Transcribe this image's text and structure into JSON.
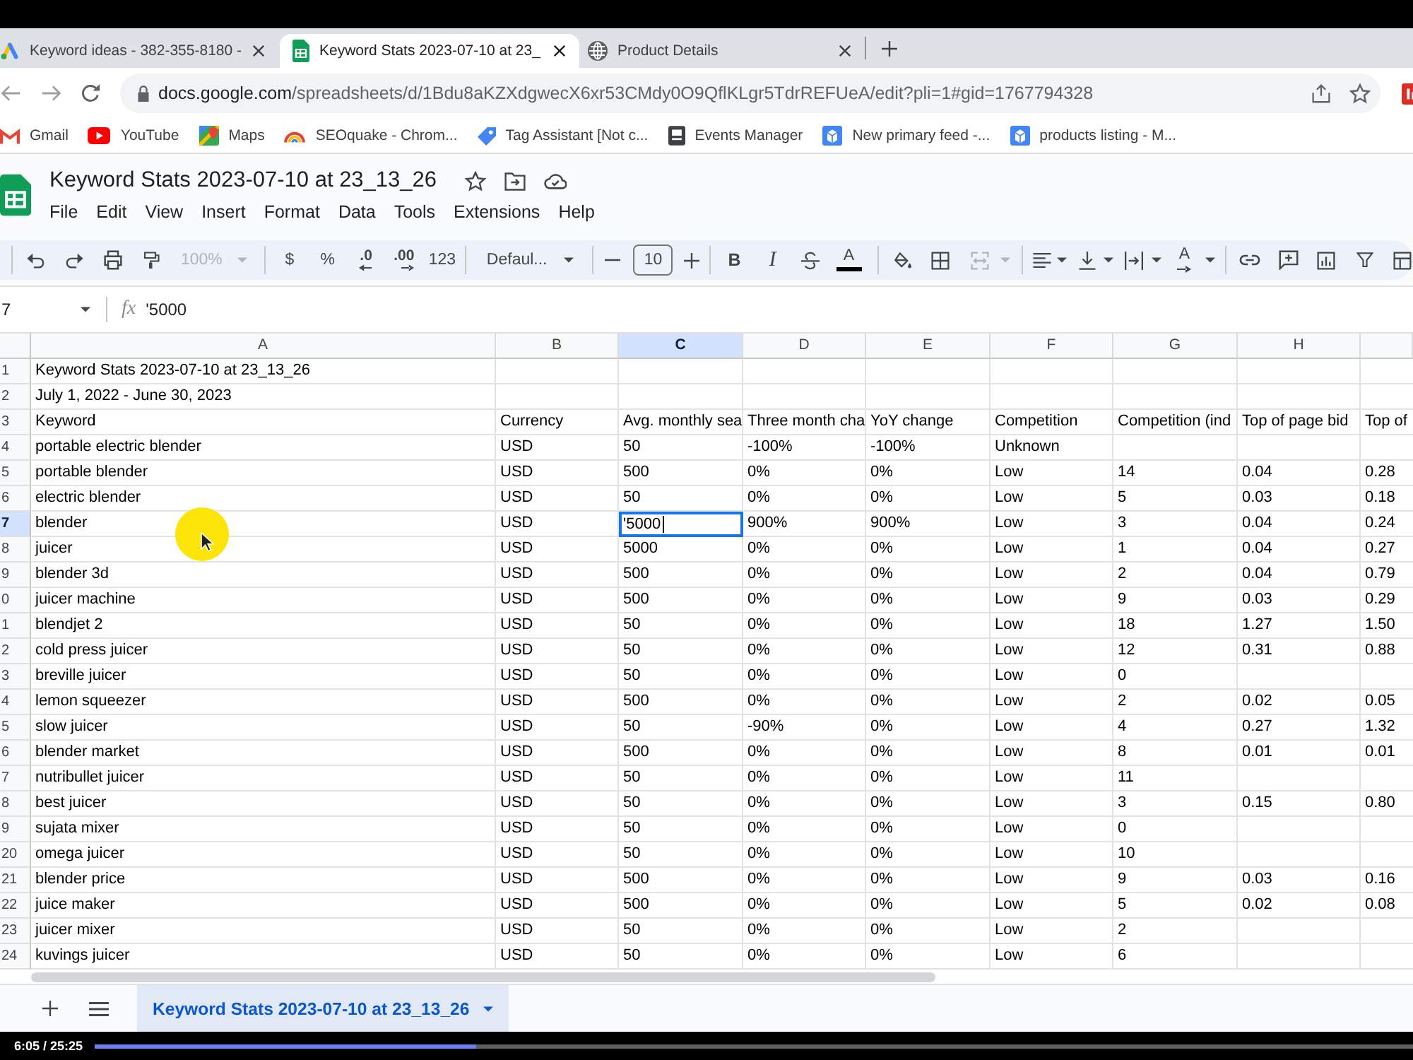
{
  "browser": {
    "tabs": [
      {
        "kind": "ads",
        "title": "Keyword ideas - 382-355-8180 -",
        "selected": false
      },
      {
        "kind": "sheets",
        "title": "Keyword Stats 2023-07-10 at 23_",
        "selected": true
      },
      {
        "kind": "globe",
        "title": "Product Details",
        "selected": false
      }
    ],
    "address": {
      "host": "docs.google.com",
      "path": "/spreadsheets/d/1Bdu8aKZXdgwecX6xr53CMdy0O9QflKLgr5TdrREFUeA/edit?pli=1#gid=1767794328"
    },
    "bookmarks": [
      {
        "kind": "gmail",
        "label": "Gmail"
      },
      {
        "kind": "youtube",
        "label": "YouTube"
      },
      {
        "kind": "maps",
        "label": "Maps"
      },
      {
        "kind": "seoquake",
        "label": "SEOquake - Chrom..."
      },
      {
        "kind": "tag",
        "label": "Tag Assistant [Not c..."
      },
      {
        "kind": "events",
        "label": "Events Manager"
      },
      {
        "kind": "merchant",
        "label": "New primary feed -..."
      },
      {
        "kind": "merchant",
        "label": "products listing - M..."
      }
    ]
  },
  "document": {
    "title": "Keyword Stats 2023-07-10 at 23_13_26",
    "menu": [
      "File",
      "Edit",
      "View",
      "Insert",
      "Format",
      "Data",
      "Tools",
      "Extensions",
      "Help"
    ]
  },
  "toolbar": [
    [
      {
        "kind": "undo",
        "disabled": false
      },
      {
        "kind": "redo",
        "disabled": false
      },
      {
        "kind": "print",
        "disabled": false
      },
      {
        "kind": "paint-format",
        "disabled": false
      },
      {
        "kind": "zoom",
        "label": "100%",
        "disabled": true
      }
    ],
    [
      {
        "kind": "currency",
        "label": "$",
        "disabled": false
      },
      {
        "kind": "percent",
        "label": "%",
        "disabled": false
      },
      {
        "kind": "decrease-decimals",
        "label": ".0",
        "disabled": false
      },
      {
        "kind": "increase-decimals",
        "label": ".00",
        "disabled": false
      },
      {
        "kind": "number-format",
        "label": "123",
        "disabled": false
      }
    ],
    [
      {
        "kind": "font",
        "label": "Defaul...",
        "disabled": false
      }
    ],
    [
      {
        "kind": "minus",
        "disabled": false
      },
      {
        "kind": "size-field",
        "label": "10",
        "disabled": false
      },
      {
        "kind": "plus",
        "disabled": false
      }
    ],
    [
      {
        "kind": "bold",
        "label": "B",
        "disabled": false
      },
      {
        "kind": "italic",
        "label": "I",
        "disabled": false
      },
      {
        "kind": "strikethrough",
        "disabled": false
      },
      {
        "kind": "text-color",
        "label": "A",
        "disabled": false
      }
    ],
    [
      {
        "kind": "fill-color",
        "disabled": false
      },
      {
        "kind": "borders",
        "disabled": false
      },
      {
        "kind": "merge",
        "disabled": true
      }
    ],
    [
      {
        "kind": "align",
        "disabled": false
      },
      {
        "kind": "valign",
        "disabled": false
      },
      {
        "kind": "wrap",
        "disabled": false
      },
      {
        "kind": "rotate",
        "label": "A",
        "disabled": false
      }
    ],
    [
      {
        "kind": "link",
        "disabled": false
      },
      {
        "kind": "comment",
        "disabled": false
      },
      {
        "kind": "chart",
        "disabled": false
      },
      {
        "kind": "filter",
        "disabled": false
      },
      {
        "kind": "views",
        "disabled": false
      }
    ]
  ],
  "formula_bar": {
    "cell": "7",
    "fx": "fx",
    "value": "'5000"
  },
  "sheet": {
    "columns": [
      {
        "label": "A",
        "selected": false
      },
      {
        "label": "B",
        "selected": false
      },
      {
        "label": "C",
        "selected": true
      },
      {
        "label": "D",
        "selected": false
      },
      {
        "label": "E",
        "selected": false
      },
      {
        "label": "F",
        "selected": false
      },
      {
        "label": "G",
        "selected": false
      },
      {
        "label": "H",
        "selected": false
      },
      {
        "selected": false
      }
    ],
    "rows": [
      {
        "number": "1",
        "selected": false,
        "cells": [
          "Keyword Stats 2023-07-10 at 23_13_26"
        ]
      },
      {
        "number": "2",
        "selected": false,
        "cells": [
          "July 1, 2022 - June 30, 2023"
        ]
      },
      {
        "number": "3",
        "selected": false,
        "cells": [
          "Keyword",
          "Currency",
          "Avg. monthly sea",
          "Three month cha",
          "YoY change",
          "Competition",
          "Competition (ind",
          "Top of page bid",
          "Top of"
        ]
      },
      {
        "number": "4",
        "selected": false,
        "cells": [
          "portable electric blender",
          "USD",
          "50",
          "-100%",
          "-100%",
          "Unknown"
        ]
      },
      {
        "number": "5",
        "selected": false,
        "cells": [
          "portable blender",
          "USD",
          "500",
          "0%",
          "0%",
          "Low",
          "14",
          "0.04",
          "0.28"
        ]
      },
      {
        "number": "6",
        "selected": false,
        "cells": [
          "electric blender",
          "USD",
          "50",
          "0%",
          "0%",
          "Low",
          "5",
          "0.03",
          "0.18"
        ]
      },
      {
        "number": "7",
        "selected": true,
        "cells": [
          "blender",
          "USD",
          "'5000",
          "900%",
          "900%",
          "Low",
          "3",
          "0.04",
          "0.24"
        ]
      },
      {
        "number": "8",
        "selected": false,
        "cells": [
          "juicer",
          "USD",
          "5000",
          "0%",
          "0%",
          "Low",
          "1",
          "0.04",
          "0.27"
        ]
      },
      {
        "number": "9",
        "selected": false,
        "cells": [
          "blender 3d",
          "USD",
          "500",
          "0%",
          "0%",
          "Low",
          "2",
          "0.04",
          "0.79"
        ]
      },
      {
        "number": "0",
        "selected": false,
        "cells": [
          "juicer machine",
          "USD",
          "500",
          "0%",
          "0%",
          "Low",
          "9",
          "0.03",
          "0.29"
        ]
      },
      {
        "number": "1",
        "selected": false,
        "cells": [
          "blendjet 2",
          "USD",
          "50",
          "0%",
          "0%",
          "Low",
          "18",
          "1.27",
          "1.50"
        ]
      },
      {
        "number": "2",
        "selected": false,
        "cells": [
          "cold press juicer",
          "USD",
          "50",
          "0%",
          "0%",
          "Low",
          "12",
          "0.31",
          "0.88"
        ]
      },
      {
        "number": "3",
        "selected": false,
        "cells": [
          "breville juicer",
          "USD",
          "50",
          "0%",
          "0%",
          "Low",
          "0"
        ]
      },
      {
        "number": "4",
        "selected": false,
        "cells": [
          "lemon squeezer",
          "USD",
          "500",
          "0%",
          "0%",
          "Low",
          "2",
          "0.02",
          "0.05"
        ]
      },
      {
        "number": "5",
        "selected": false,
        "cells": [
          "slow juicer",
          "USD",
          "50",
          "-90%",
          "0%",
          "Low",
          "4",
          "0.27",
          "1.32"
        ]
      },
      {
        "number": "6",
        "selected": false,
        "cells": [
          "blender market",
          "USD",
          "500",
          "0%",
          "0%",
          "Low",
          "8",
          "0.01",
          "0.01"
        ]
      },
      {
        "number": "7",
        "selected": false,
        "cells": [
          "nutribullet juicer",
          "USD",
          "50",
          "0%",
          "0%",
          "Low",
          "11"
        ]
      },
      {
        "number": "8",
        "selected": false,
        "cells": [
          "best juicer",
          "USD",
          "50",
          "0%",
          "0%",
          "Low",
          "3",
          "0.15",
          "0.80"
        ]
      },
      {
        "number": "9",
        "selected": false,
        "cells": [
          "sujata mixer",
          "USD",
          "50",
          "0%",
          "0%",
          "Low",
          "0"
        ]
      },
      {
        "number": "20",
        "selected": false,
        "cells": [
          "omega juicer",
          "USD",
          "50",
          "0%",
          "0%",
          "Low",
          "10"
        ]
      },
      {
        "number": "21",
        "selected": false,
        "cells": [
          "blender price",
          "USD",
          "500",
          "0%",
          "0%",
          "Low",
          "9",
          "0.03",
          "0.16"
        ]
      },
      {
        "number": "22",
        "selected": false,
        "cells": [
          "juice maker",
          "USD",
          "500",
          "0%",
          "0%",
          "Low",
          "5",
          "0.02",
          "0.08"
        ]
      },
      {
        "number": "23",
        "selected": false,
        "cells": [
          "juicer mixer",
          "USD",
          "50",
          "0%",
          "0%",
          "Low",
          "2"
        ]
      },
      {
        "number": "24",
        "selected": false,
        "cells": [
          "kuvings juicer",
          "USD",
          "50",
          "0%",
          "0%",
          "Low",
          "6"
        ]
      }
    ]
  },
  "sheet_tabs": [
    {
      "label": "Keyword Stats 2023-07-10 at 23_13_26",
      "selected": true
    }
  ],
  "video_player": {
    "time": "6:05 / 25:25",
    "level": 0.29
  }
}
